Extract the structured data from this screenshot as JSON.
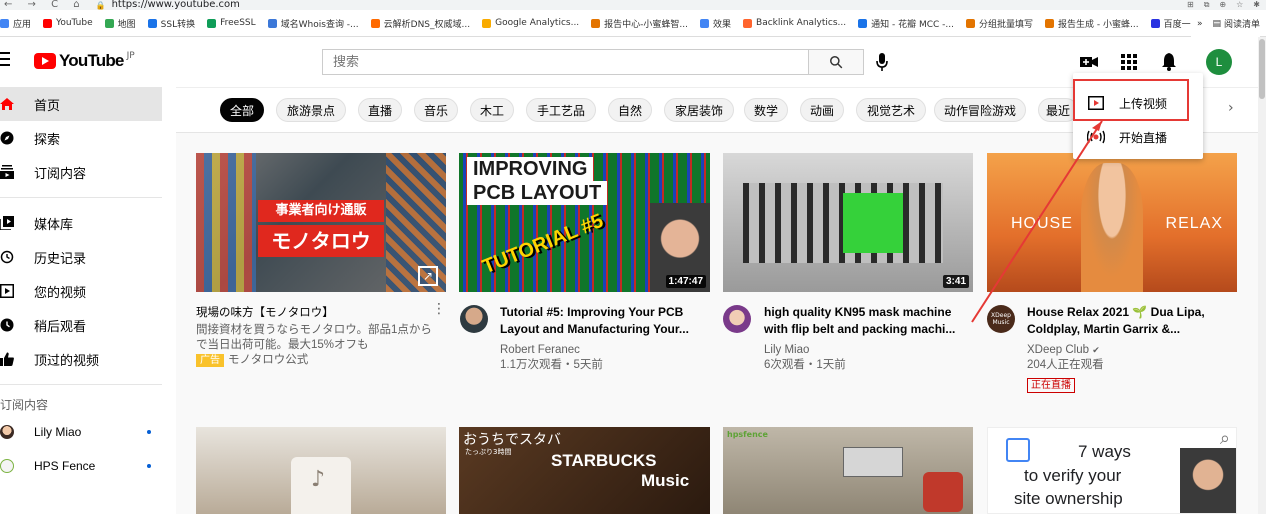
{
  "browser": {
    "nav_glyphs": "← → C ⌂",
    "url": "https://www.youtube.com",
    "bookmarks": [
      {
        "label": "应用",
        "color": "#4285f4"
      },
      {
        "label": "YouTube",
        "color": "#ff0000"
      },
      {
        "label": "地图",
        "color": "#34a853"
      },
      {
        "label": "SSL转换",
        "color": "#1a73e8"
      },
      {
        "label": "FreeSSL",
        "color": "#0f9d58"
      },
      {
        "label": "域名Whois查询 -...",
        "color": "#3c78d8"
      },
      {
        "label": "云解析DNS_权威域...",
        "color": "#ff6a00"
      },
      {
        "label": "Google Analytics...",
        "color": "#f9ab00"
      },
      {
        "label": "报告中心-小蜜蜂智...",
        "color": "#e37400"
      },
      {
        "label": "效果",
        "color": "#4285f4"
      },
      {
        "label": "Backlink Analytics...",
        "color": "#ff642d"
      },
      {
        "label": "通知 - 花瓣 MCC -...",
        "color": "#1a73e8"
      },
      {
        "label": "分组批量填写",
        "color": "#e37400"
      },
      {
        "label": "报告生成 - 小蜜蜂...",
        "color": "#e37400"
      },
      {
        "label": "百度一下，你就知道",
        "color": "#2932e1"
      }
    ],
    "more_bookmarks": "»",
    "reading_list": "阅读清单"
  },
  "header": {
    "logo_text": "YouTube",
    "region": "JP",
    "search_placeholder": "搜索",
    "avatar_letter": "L"
  },
  "sidebar": {
    "items": [
      {
        "label": "首页",
        "icon": "home-icon"
      },
      {
        "label": "探索",
        "icon": "compass-icon"
      },
      {
        "label": "订阅内容",
        "icon": "subscriptions-icon"
      },
      {
        "label": "媒体库",
        "icon": "library-icon"
      },
      {
        "label": "历史记录",
        "icon": "history-icon"
      },
      {
        "label": "您的视频",
        "icon": "your-videos-icon"
      },
      {
        "label": "稍后观看",
        "icon": "watch-later-icon"
      },
      {
        "label": "顶过的视频",
        "icon": "liked-icon"
      }
    ],
    "subscriptions_heading": "订阅内容",
    "subscriptions": [
      {
        "label": "Lily Miao"
      },
      {
        "label": "HPS Fence"
      }
    ]
  },
  "chips": [
    "全部",
    "旅游景点",
    "直播",
    "音乐",
    "木工",
    "手工艺品",
    "自然",
    "家居装饰",
    "数学",
    "动画",
    "视觉艺术",
    "动作冒险游戏",
    "最近"
  ],
  "videos": [
    {
      "title": "現場の味方【モノタロウ】",
      "desc": "間接資材を買うならモノタロウ。部品1点からで当日出荷可能。最大15%オフも",
      "ad": "广告",
      "channel": "モノタロウ公式",
      "thumb_text1": "事業者向け通販",
      "thumb_text2": "モノタロウ"
    },
    {
      "title": "Tutorial #5: Improving Your PCB Layout and Manufacturing Your...",
      "channel": "Robert Feranec",
      "stats": "1.1万次观看・5天前",
      "duration": "1:47:47",
      "thumb_text1": "IMPROVING",
      "thumb_text2": "PCB LAYOUT",
      "thumb_text3": "TUTORIAL #5"
    },
    {
      "title": "high quality KN95 mask machine with flip belt and packing machi...",
      "channel": "Lily Miao",
      "stats": "6次观看・1天前",
      "duration": "3:41"
    },
    {
      "title": "House Relax 2021 🌱 Dua Lipa, Coldplay, Martin Garrix &...",
      "channel": "XDeep Club",
      "verified": "✔",
      "stats": "204人正在观看",
      "live": "正在直播",
      "thumb_left": "HOUSE",
      "thumb_right": "RELAX",
      "avatar_text": "XDeep Music"
    }
  ],
  "row2": {
    "thumb2_text1": "おうちでスタバ",
    "thumb2_text0": "たっぷり3時間",
    "thumb2_text2": "STARBUCKS",
    "thumb2_text3": "Music",
    "thumb3_text": "hpsfence",
    "thumb4_text1": "7 ways",
    "thumb4_text2": "to verify your",
    "thumb4_text3": "site ownership"
  },
  "upload_menu": {
    "upload_label": "上传视频",
    "live_label": "开始直播"
  },
  "colors": {
    "brand_red": "#ff0000",
    "annotation_red": "#e53935",
    "ad_yellow": "#f9c22b",
    "avatar_green": "#1e8e3e"
  }
}
